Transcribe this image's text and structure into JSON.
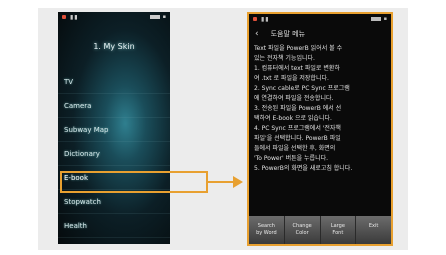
{
  "left_phone": {
    "title": "1. My Skin",
    "menu_items": [
      "TV",
      "Camera",
      "Subway Map",
      "Dictionary",
      "E-book",
      "Stopwatch",
      "Health"
    ],
    "selected_index": 4
  },
  "right_phone": {
    "header_title": "도움말 메뉴",
    "body_lines": [
      "Text 파일을 PowerB 읽어서 볼 수",
      "있는 전자책 기능입니다.",
      "",
      "1. 컴퓨터에서 text 파일로 변환하",
      "   여 .txt 로 파일을 저장합니다.",
      "2. Sync cable로 PC Sync 프로그램",
      "   에 연결하여 파일을 전송합니다.",
      "3. 전송된 파일을 PowerB 에서 선",
      "   택하여 E-book 으로 읽습니다.",
      "4. PC Sync 프로그램에서 '전자책",
      "   파일'을 선택합니다. PowerB 파일",
      "   들에서 파일을 선택한 후, 화면의",
      "   'To Power' 버튼을 누릅니다.",
      "5. PowerB의 화면을 새로고침 합니다."
    ],
    "bottom_buttons": [
      "Search\nby Word",
      "Change\nColor",
      "Large\nFont",
      "Exit"
    ]
  }
}
